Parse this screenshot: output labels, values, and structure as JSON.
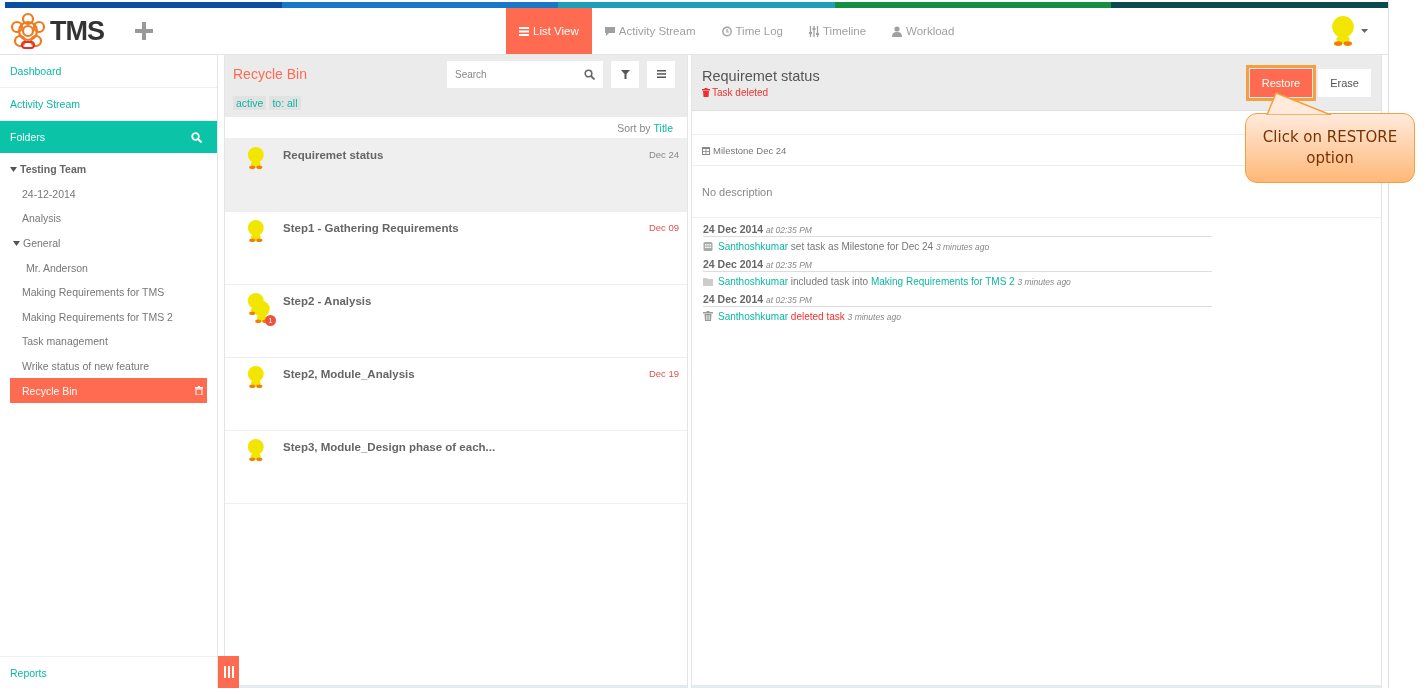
{
  "header": {
    "logo_text": "TMS",
    "nav": [
      {
        "label": "List View",
        "kind": "list",
        "selected": true
      },
      {
        "label": "Activity Stream",
        "kind": "stream",
        "selected": false
      },
      {
        "label": "Time Log",
        "kind": "timelog",
        "selected": false
      },
      {
        "label": "Timeline",
        "kind": "timeline",
        "selected": false
      },
      {
        "label": "Workload",
        "kind": "workload",
        "selected": false
      }
    ]
  },
  "sidebar": {
    "links": [
      "Dashboard",
      "Activity Stream"
    ],
    "folders_title": "Folders",
    "tree": [
      {
        "label": "Testing Team",
        "expanded": true,
        "selected": false,
        "children": [
          {
            "label": "24-12-2014",
            "selected": false
          },
          {
            "label": "Analysis",
            "selected": false
          },
          {
            "label": "General",
            "expanded": true,
            "selected": false,
            "children": [
              {
                "label": "Mr. Anderson",
                "selected": false
              }
            ]
          },
          {
            "label": "Making Requirements for TMS",
            "selected": false
          },
          {
            "label": "Making Requirements for TMS 2",
            "selected": false
          },
          {
            "label": "Task management",
            "selected": false
          },
          {
            "label": "Wrike status of new feature",
            "selected": false
          },
          {
            "label": "Recycle Bin",
            "kind": "trash",
            "selected": true
          }
        ]
      }
    ],
    "footer_link": "Reports"
  },
  "task_list": {
    "title": "Recycle Bin",
    "search": {
      "placeholder": "Search"
    },
    "filters": [
      "active",
      "to: all"
    ],
    "sort_label": "Sort by",
    "sort_value": "Title",
    "tasks": [
      {
        "title": "Requiremet status",
        "date": "Dec 24",
        "overdue": false,
        "selected": true,
        "kind": "single"
      },
      {
        "title": "Step1 - Gathering Requirements",
        "date": "Dec 09",
        "overdue": true,
        "selected": false,
        "kind": "single"
      },
      {
        "title": "Step2 - Analysis",
        "selected": false,
        "kind": "group",
        "badge": "1"
      },
      {
        "title": "Step2, Module_Analysis",
        "date": "Dec 19",
        "overdue": true,
        "selected": false,
        "kind": "single"
      },
      {
        "title": "Step3, Module_Design phase of each...",
        "selected": false,
        "kind": "single"
      }
    ]
  },
  "detail": {
    "title": "Requiremet status",
    "status": "Task deleted",
    "buttons": [
      "Restore",
      "Erase"
    ],
    "milestone": "Milestone Dec 24",
    "description": "No description",
    "activity": [
      {
        "date": "24 Dec 2014",
        "time": "at 02:35 PM",
        "kind": "milestone",
        "actor": "Santhoshkumar",
        "action": "set task as Milestone for Dec 24",
        "ago": "3 minutes ago"
      },
      {
        "date": "24 Dec 2014",
        "time": "at 02:35 PM",
        "kind": "folder",
        "actor": "Santhoshkumar",
        "action": "included task into",
        "link": "Making Requirements for TMS 2",
        "ago": "3 minutes ago"
      },
      {
        "date": "24 Dec 2014",
        "time": "at 02:35 PM",
        "kind": "delete",
        "actor": "Santhoshkumar",
        "action": "deleted task",
        "ago": "3 minutes ago"
      }
    ]
  },
  "callout": {
    "text": "Click on RESTORE option"
  }
}
